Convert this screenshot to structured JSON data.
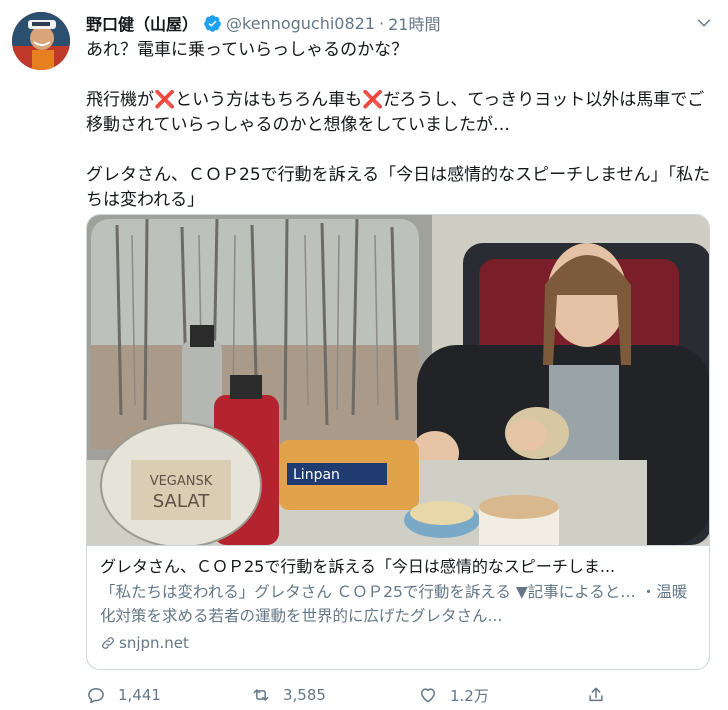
{
  "tweet": {
    "author_name": "野口健（山屋）",
    "handle": "@kennoguchi0821",
    "separator": "·",
    "time": "21時間",
    "line1": "あれ？電車に乗っていらっしゃるのかな？",
    "para2_a": "飛行機が",
    "para2_b": "という方はもちろん車も",
    "para2_c": "だろうし、てっきりヨット以外は馬車でご移動されていらっしゃるのかと想像をしていましたが…",
    "cross_mark": "❌",
    "para3": "グレタさん、ＣＯＰ25で行動を訴える「今日は感情的なスピーチしません」「私たちは変われる」"
  },
  "card": {
    "title": "グレタさん、ＣＯＰ25で行動を訴える「今日は感情的なスピーチしま...",
    "description": "「私たちは変われる」グレタさん ＣＯＰ25で行動を訴える ▼記事によると… ・温暖化対策を求める若者の運動を世界的に広げたグレタさん...",
    "domain": "snjpn.net",
    "photo_labels": {
      "salad_line1": "VEGANSK",
      "salad_line2": "SALAT",
      "bread": "Linpan"
    }
  },
  "actions": {
    "replies": "1,441",
    "retweets": "3,585",
    "likes": "1.2万"
  },
  "colors": {
    "verified": "#1da1f2",
    "muted": "#657786",
    "cross": "#d0112b"
  },
  "icons": [
    "verified-badge-icon",
    "chevron-down-icon",
    "link-icon",
    "reply-icon",
    "retweet-icon",
    "like-icon",
    "share-icon"
  ]
}
